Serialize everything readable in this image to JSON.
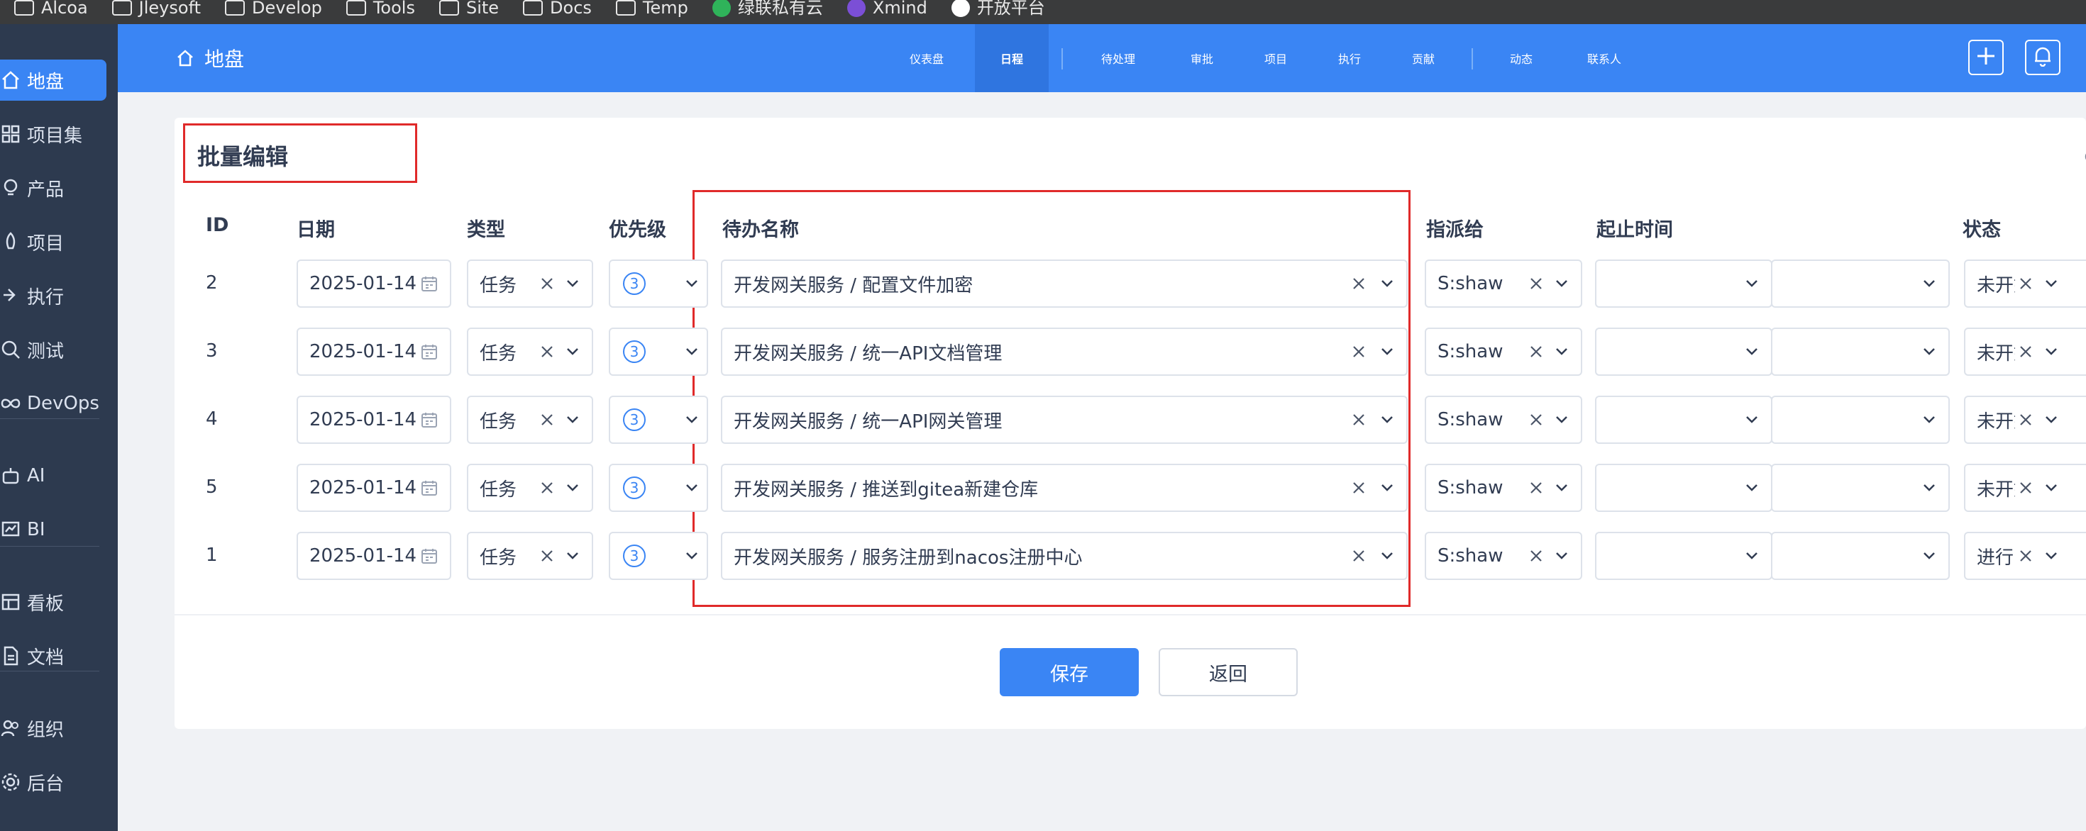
{
  "bookmarks": [
    {
      "label": "Alcoa",
      "type": "folder"
    },
    {
      "label": "Jleysoft",
      "type": "folder"
    },
    {
      "label": "Develop",
      "type": "folder"
    },
    {
      "label": "Tools",
      "type": "folder"
    },
    {
      "label": "Site",
      "type": "folder"
    },
    {
      "label": "Docs",
      "type": "folder"
    },
    {
      "label": "Temp",
      "type": "folder"
    },
    {
      "label": "绿联私有云",
      "type": "link",
      "color": "#2fb35a"
    },
    {
      "label": "Xmind",
      "type": "link",
      "color": "#7b4fd6"
    },
    {
      "label": "开放平台",
      "type": "link",
      "color": "#ffffff"
    }
  ],
  "sidebar": {
    "items": [
      {
        "label": "地盘",
        "icon": "home-icon",
        "active": true
      },
      {
        "label": "项目集",
        "icon": "grid-icon"
      },
      {
        "label": "产品",
        "icon": "bulb-icon"
      },
      {
        "label": "项目",
        "icon": "rocket-icon"
      },
      {
        "label": "执行",
        "icon": "run-icon"
      },
      {
        "label": "测试",
        "icon": "test-icon"
      },
      {
        "label": "DevOps",
        "icon": "infinity-icon"
      },
      {
        "label": "AI",
        "icon": "robot-icon"
      },
      {
        "label": "BI",
        "icon": "chart-icon"
      },
      {
        "label": "看板",
        "icon": "kanban-icon"
      },
      {
        "label": "文档",
        "icon": "doc-icon"
      },
      {
        "label": "组织",
        "icon": "people-icon"
      },
      {
        "label": "后台",
        "icon": "gear-icon"
      }
    ]
  },
  "header": {
    "home_label": "地盘",
    "nav": [
      "仪表盘",
      "日程",
      "待处理",
      "审批",
      "项目",
      "执行",
      "贡献",
      "动态",
      "联系人"
    ],
    "active_nav": "日程"
  },
  "form": {
    "title": "批量编辑",
    "columns": [
      "ID",
      "日期",
      "类型",
      "优先级",
      "待办名称",
      "指派给",
      "起止时间",
      "状态"
    ],
    "rows": [
      {
        "id": "2",
        "date": "2025-01-14",
        "type": "任务",
        "priority": "3",
        "name": "开发网关服务 / 配置文件加密",
        "assignee": "S:shaw",
        "status": "未开始"
      },
      {
        "id": "3",
        "date": "2025-01-14",
        "type": "任务",
        "priority": "3",
        "name": "开发网关服务 / 统一API文档管理",
        "assignee": "S:shaw",
        "status": "未开始"
      },
      {
        "id": "4",
        "date": "2025-01-14",
        "type": "任务",
        "priority": "3",
        "name": "开发网关服务 / 统一API网关管理",
        "assignee": "S:shaw",
        "status": "未开始"
      },
      {
        "id": "5",
        "date": "2025-01-14",
        "type": "任务",
        "priority": "3",
        "name": "开发网关服务 / 推送到gitea新建仓库",
        "assignee": "S:shaw",
        "status": "未开始"
      },
      {
        "id": "1",
        "date": "2025-01-14",
        "type": "任务",
        "priority": "3",
        "name": "开发网关服务 / 服务注册到nacos注册中心",
        "assignee": "S:shaw",
        "status": "进行中"
      }
    ],
    "save_label": "保存",
    "back_label": "返回"
  }
}
